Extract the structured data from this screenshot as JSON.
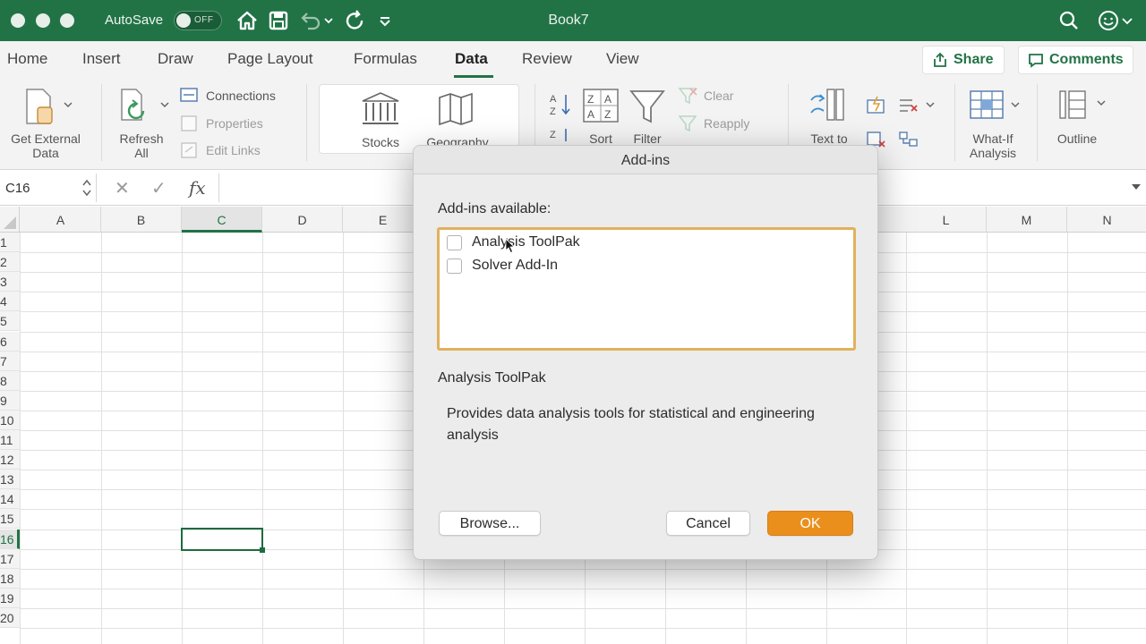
{
  "titlebar": {
    "autosave_label": "AutoSave",
    "autosave_state": "OFF",
    "document_title": "Book7"
  },
  "tabs": [
    {
      "label": "Home"
    },
    {
      "label": "Insert"
    },
    {
      "label": "Draw"
    },
    {
      "label": "Page Layout"
    },
    {
      "label": "Formulas"
    },
    {
      "label": "Data",
      "active": true
    },
    {
      "label": "Review"
    },
    {
      "label": "View"
    }
  ],
  "share_label": "Share",
  "comments_label": "Comments",
  "ribbon": {
    "get_external_data": "Get External\nData",
    "refresh_all": "Refresh\nAll",
    "connections": "Connections",
    "properties": "Properties",
    "edit_links": "Edit Links",
    "stocks": "Stocks",
    "geography": "Geography",
    "sort": "Sort",
    "filter": "Filter",
    "clear": "Clear",
    "reapply": "Reapply",
    "text_to": "Text to",
    "what_if": "What-If\nAnalysis",
    "outline": "Outline"
  },
  "formula_bar": {
    "name_box": "C16",
    "cancel_symbol": "✕",
    "enter_symbol": "✓",
    "fx_symbol": "fx"
  },
  "grid": {
    "columns": [
      "A",
      "B",
      "C",
      "D",
      "E",
      "L",
      "M",
      "N"
    ],
    "selected_column": "C",
    "rows": [
      "1",
      "2",
      "3",
      "4",
      "5",
      "6",
      "7",
      "8",
      "9",
      "10",
      "11",
      "12",
      "13",
      "14",
      "15",
      "16",
      "17",
      "18",
      "19",
      "20"
    ],
    "selected_row": "16"
  },
  "dialog": {
    "title": "Add-ins",
    "available_label": "Add-ins available:",
    "items": [
      {
        "label": "Analysis ToolPak",
        "checked": false
      },
      {
        "label": "Solver Add-In",
        "checked": false
      }
    ],
    "selected_name": "Analysis ToolPak",
    "description": "Provides data analysis tools for statistical and engineering analysis",
    "browse_label": "Browse...",
    "cancel_label": "Cancel",
    "ok_label": "OK"
  },
  "colors": {
    "excel_green": "#217346",
    "ok_orange": "#eb8f1c",
    "list_focus": "#e2b15c"
  }
}
